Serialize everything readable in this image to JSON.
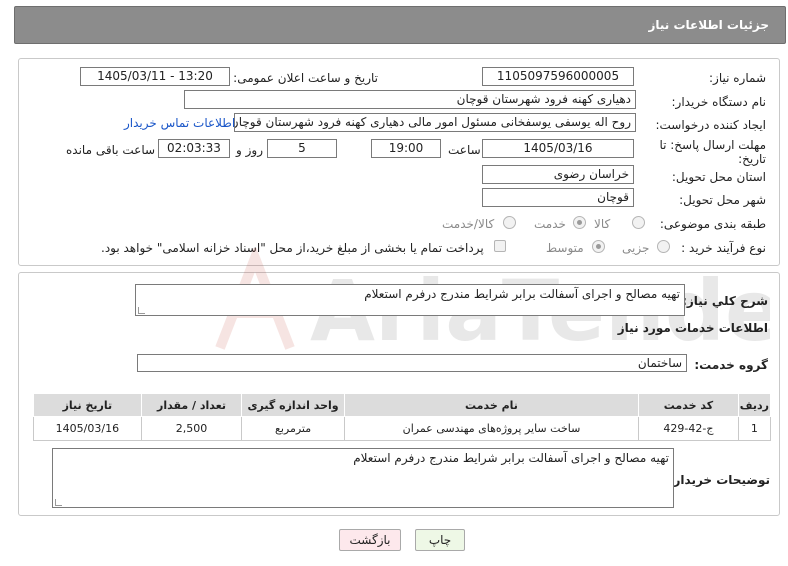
{
  "header": {
    "title": "جزئیات اطلاعات نیاز"
  },
  "form": {
    "need_number_label": "شماره نیاز:",
    "need_number": "1105097596000005",
    "announce_label": "تاریخ و ساعت اعلان عمومی:",
    "announce_value": "1405/03/11 - 13:20",
    "buyer_org_label": "نام دستگاه خریدار:",
    "buyer_org": "دهیاری کهنه فرود شهرستان قوچان",
    "creator_label": "ایجاد کننده درخواست:",
    "creator": "روح اله یوسفی یوسفخانی مسئول امور مالی دهیاری کهنه فرود شهرستان قوچان",
    "contact_link": "اطلاعات تماس خریدار",
    "deadline_label_1": "مهلت ارسال پاسخ: تا",
    "deadline_label_2": "تاریخ:",
    "deadline_date": "1405/03/16",
    "time_label": "ساعت",
    "deadline_time": "19:00",
    "days_value": "5",
    "days_label": "روز و",
    "remaining_time": "02:03:33",
    "remaining_label": "ساعت باقی مانده",
    "province_label": "استان محل تحویل:",
    "province": "خراسان رضوی",
    "city_label": "شهر محل تحویل:",
    "city": "قوچان",
    "category_label": "طبقه بندی موضوعی:",
    "category_options": [
      "کالا",
      "خدمت",
      "کالا/خدمت"
    ],
    "process_label": "نوع فرآیند خرید :",
    "process_options": [
      "جزیی",
      "متوسط"
    ],
    "payment_note": "پرداخت تمام یا بخشی از مبلغ خرید،از محل \"اسناد خزانه اسلامی\" خواهد بود."
  },
  "summary": {
    "label": "شرح کلي نياز:",
    "text": "تهیه مصالح و اجرای آسفالت برابر شرایط مندرج درفرم استعلام",
    "services_title": "اطلاعات خدمات مورد نیاز",
    "group_label": "گروه خدمت:",
    "group_value": "ساختمان"
  },
  "table": {
    "headers": [
      "ردیف",
      "کد خدمت",
      "نام خدمت",
      "واحد اندازه گیری",
      "تعداد / مقدار",
      "تاریخ نیاز"
    ],
    "rows": [
      [
        "1",
        "ج-42-429",
        "ساخت سایر پروژه‌های مهندسی عمران",
        "مترمربع",
        "2,500",
        "1405/03/16"
      ]
    ]
  },
  "buyer_notes": {
    "label": "توضیحات خریدار:",
    "text": "تهیه مصالح و اجرای آسفالت برابر شرایط مندرج درفرم استعلام"
  },
  "buttons": {
    "print": "چاپ",
    "back": "بازگشت"
  },
  "watermark": {
    "text": "AriaTender.neT"
  },
  "colors": {
    "header_bg": "#8c8c8c",
    "link": "#1a56c8",
    "back_btn_bg": "#fde8ec",
    "print_btn_bg": "#eef8e6"
  }
}
